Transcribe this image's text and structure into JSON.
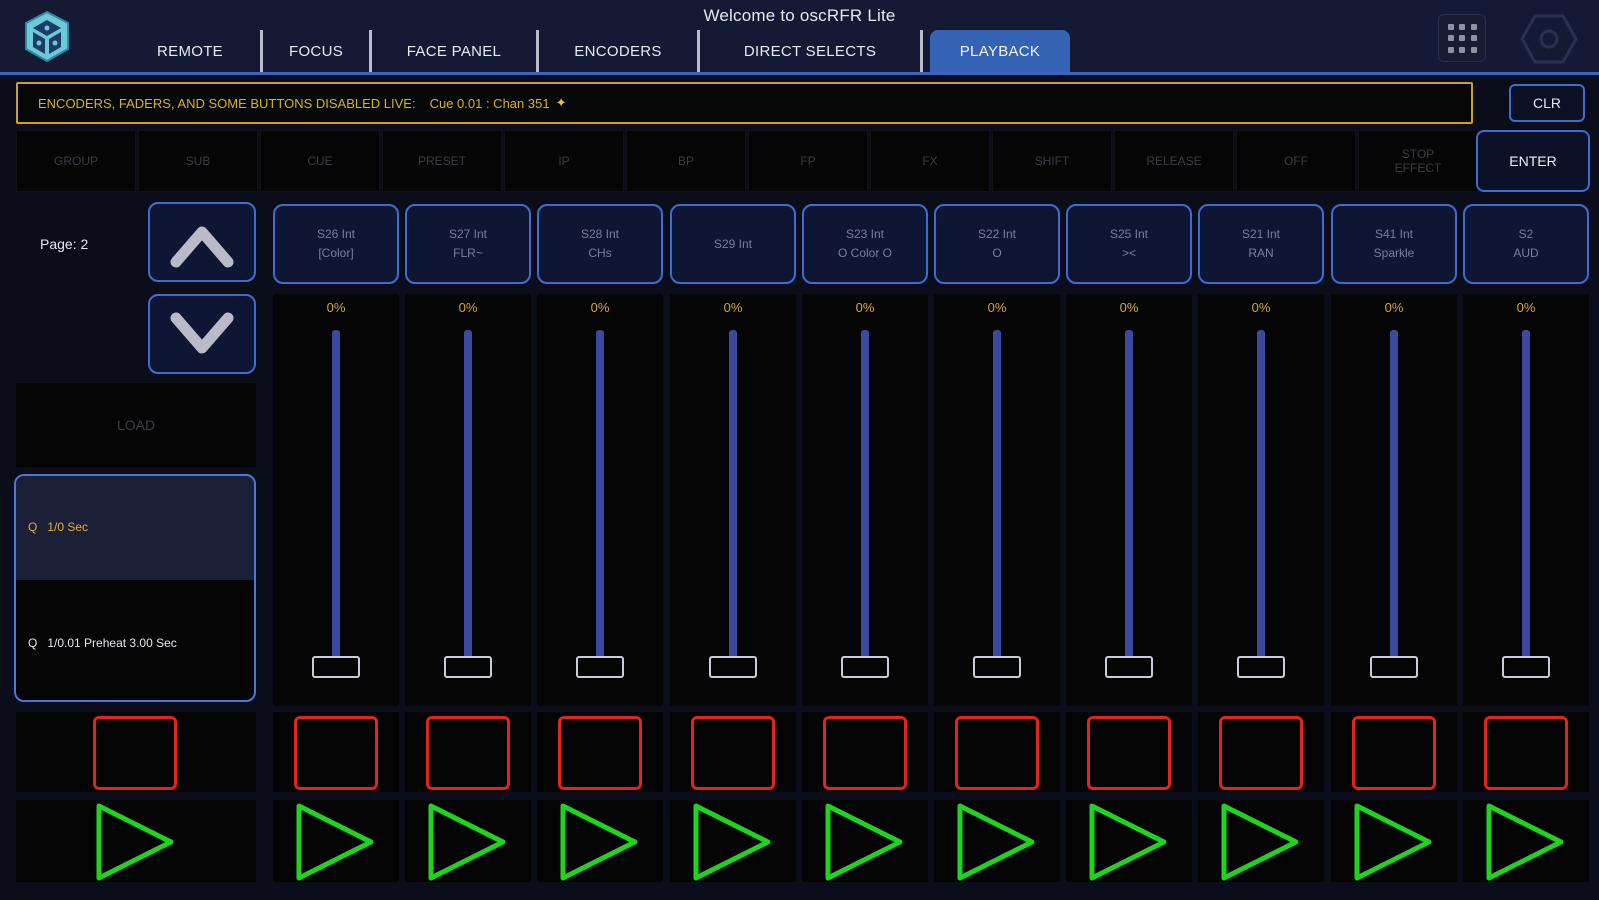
{
  "app": {
    "title": "Welcome to oscRFR Lite"
  },
  "tabs": [
    {
      "label": "REMOTE",
      "active": false
    },
    {
      "label": "FOCUS",
      "active": false
    },
    {
      "label": "FACE PANEL",
      "active": false
    },
    {
      "label": "ENCODERS",
      "active": false
    },
    {
      "label": "DIRECT SELECTS",
      "active": false
    },
    {
      "label": "PLAYBACK",
      "active": true
    }
  ],
  "status": {
    "message": "ENCODERS, FADERS, AND SOME BUTTONS DISABLED LIVE:",
    "cue": "Cue 0.01 : Chan 351",
    "star": "✦"
  },
  "clear_label": "CLR",
  "keys": [
    {
      "label": "GROUP"
    },
    {
      "label": "SUB"
    },
    {
      "label": "CUE"
    },
    {
      "label": "PRESET"
    },
    {
      "label": "IP"
    },
    {
      "label": "BP"
    },
    {
      "label": "FP"
    },
    {
      "label": "FX"
    },
    {
      "label": "SHIFT"
    },
    {
      "label": "RELEASE"
    },
    {
      "label": "OFF"
    },
    {
      "label": "STOP\nEFFECT"
    }
  ],
  "enter_label": "ENTER",
  "page": {
    "label": "Page: 2"
  },
  "load_label": "LOAD",
  "cue_list": {
    "active": {
      "q": "Q",
      "text": "1/0 Sec"
    },
    "pending": {
      "q": "Q",
      "text": "1/0.01 Preheat 3.00 Sec"
    }
  },
  "channels": [
    {
      "line1": "S26 Int",
      "line2": "[Color]",
      "level": "0%",
      "level_value": 0
    },
    {
      "line1": "S27 Int",
      "line2": "FLR~",
      "level": "0%",
      "level_value": 0
    },
    {
      "line1": "S28 Int",
      "line2": "CHs",
      "level": "0%",
      "level_value": 0
    },
    {
      "line1": "S29 Int",
      "line2": "",
      "level": "0%",
      "level_value": 0
    },
    {
      "line1": "S23 Int",
      "line2": "O Color O",
      "level": "0%",
      "level_value": 0
    },
    {
      "line1": "S22 Int",
      "line2": "O",
      "level": "0%",
      "level_value": 0
    },
    {
      "line1": "S25 Int",
      "line2": "><",
      "level": "0%",
      "level_value": 0
    },
    {
      "line1": "S21 Int",
      "line2": "RAN",
      "level": "0%",
      "level_value": 0
    },
    {
      "line1": "S41 Int",
      "line2": "Sparkle",
      "level": "0%",
      "level_value": 0
    },
    {
      "line1": "S2",
      "line2": "AUD",
      "level": "0%",
      "level_value": 0
    }
  ],
  "colors": {
    "accent": "#3f6cd0",
    "active_tab": "#3563b4",
    "stop": "#e2231e",
    "go": "#1fd31f",
    "warning": "#d8b12c",
    "fader_track": "#3b4a9c"
  },
  "icons": {
    "logo": "cube-logo-icon",
    "grid": "grid-menu-icon",
    "settings": "hexagon-settings-icon",
    "page_up": "chevron-up-icon",
    "page_down": "chevron-down-icon",
    "stop": "stop-square-icon",
    "go": "play-triangle-icon"
  }
}
